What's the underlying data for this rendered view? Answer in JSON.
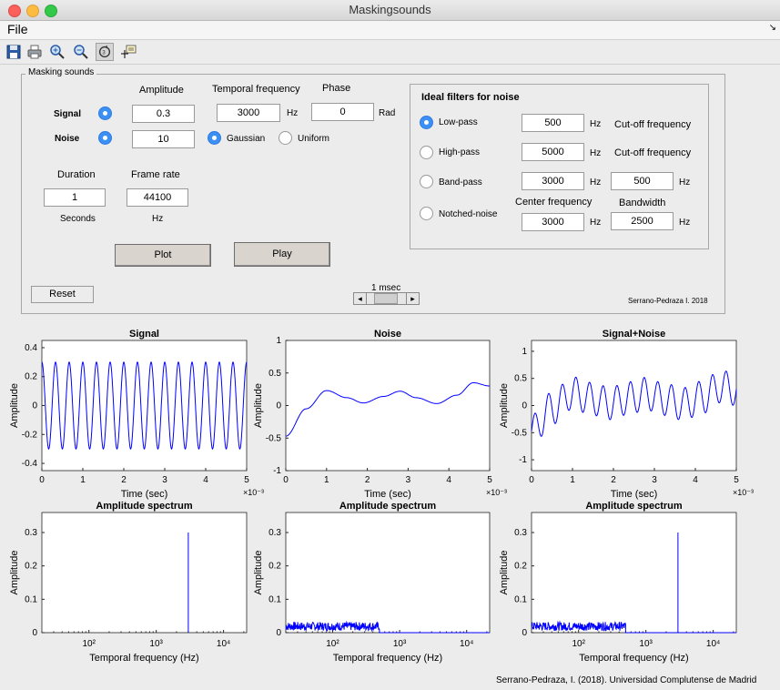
{
  "window": {
    "title": "Maskingsounds"
  },
  "menu": {
    "file": "File",
    "overflow": "↘"
  },
  "toolbar": {
    "items": [
      "save-icon",
      "print-icon",
      "zoom-in-icon",
      "zoom-out-icon",
      "rotate-3d-icon",
      "data-cursor-icon"
    ]
  },
  "panel": {
    "title": "Masking sounds",
    "headers": {
      "amplitude": "Amplitude",
      "temporal_frequency": "Temporal frequency",
      "phase": "Phase"
    },
    "signal": {
      "label": "Signal",
      "amplitude": "0.3",
      "frequency": "3000",
      "frequency_unit": "Hz",
      "phase": "0",
      "phase_unit": "Rad",
      "selected": true
    },
    "noise": {
      "label": "Noise",
      "amplitude": "10",
      "selected": true,
      "gaussian": "Gaussian",
      "uniform": "Uniform",
      "distribution": "Gaussian"
    },
    "duration": {
      "label": "Duration",
      "value": "1",
      "unit": "Seconds"
    },
    "frame_rate": {
      "label": "Frame rate",
      "value": "44100",
      "unit": "Hz"
    },
    "plot_button": "Plot",
    "play_button": "Play",
    "reset_button": "Reset",
    "slider": {
      "label": "1 msec",
      "left": "◂",
      "right": "▸"
    },
    "credit": "Serrano-Pedraza I. 2018",
    "filters": {
      "title": "Ideal filters for noise",
      "selected": "Low-pass",
      "lowpass": {
        "label": "Low-pass",
        "value": "500",
        "unit": "Hz",
        "desc": "Cut-off frequency"
      },
      "highpass": {
        "label": "High-pass",
        "value": "5000",
        "unit": "Hz",
        "desc": "Cut-off frequency"
      },
      "bandpass": {
        "label": "Band-pass",
        "center": "3000",
        "center_unit": "Hz",
        "bandwidth": "500",
        "bandwidth_unit": "Hz"
      },
      "notched": {
        "label": "Notched-noise",
        "center_label": "Center frequency",
        "bandwidth_label": "Bandwidth",
        "center": "3000",
        "center_unit": "Hz",
        "bandwidth": "2500",
        "bandwidth_unit": "Hz"
      }
    }
  },
  "footer": "Serrano-Pedraza, I. (2018). Universidad Complutense de Madrid",
  "colors": {
    "line": "#0000ff",
    "accent": "#3b8ff5"
  },
  "chart_data": [
    {
      "type": "line",
      "title": "Signal",
      "xlabel": "Time (sec)",
      "ylabel": "Amplitude",
      "x_multiplier": "×10⁻³",
      "xlim": [
        0,
        5
      ],
      "ylim": [
        -0.45,
        0.45
      ],
      "xticks": [
        0,
        1,
        2,
        3,
        4,
        5
      ],
      "yticks": [
        -0.4,
        -0.2,
        0,
        0.2,
        0.4
      ],
      "xticklabels": [
        "0",
        "1",
        "2",
        "3",
        "4",
        "5"
      ],
      "yticklabels": [
        "-0.4",
        "-0.2",
        "0",
        "0.2",
        "0.4"
      ],
      "series": [
        {
          "kind": "sine",
          "amplitude": 0.3,
          "frequency_khz": 3,
          "phase": 0
        }
      ]
    },
    {
      "type": "line",
      "title": "Noise",
      "xlabel": "Time (sec)",
      "ylabel": "Amplitude",
      "x_multiplier": "×10⁻³",
      "xlim": [
        0,
        5
      ],
      "ylim": [
        -1,
        1
      ],
      "xticks": [
        0,
        1,
        2,
        3,
        4,
        5
      ],
      "yticks": [
        -1,
        -0.5,
        0,
        0.5,
        1
      ],
      "xticklabels": [
        "0",
        "1",
        "2",
        "3",
        "4",
        "5"
      ],
      "yticklabels": [
        "-1",
        "-0.5",
        "0",
        "0.5",
        "1"
      ],
      "series": [
        {
          "kind": "points",
          "x": [
            0,
            0.5,
            1.0,
            1.5,
            1.9,
            2.4,
            2.8,
            3.2,
            3.7,
            4.2,
            4.6,
            5.0
          ],
          "y": [
            -0.47,
            -0.05,
            0.23,
            0.12,
            0.04,
            0.14,
            0.22,
            0.12,
            0.03,
            0.16,
            0.35,
            0.3
          ]
        }
      ]
    },
    {
      "type": "line",
      "title": "Signal+Noise",
      "xlabel": "Time (sec)",
      "ylabel": "Amplitude",
      "x_multiplier": "×10⁻³",
      "xlim": [
        0,
        5
      ],
      "ylim": [
        -1.2,
        1.2
      ],
      "xticks": [
        0,
        1,
        2,
        3,
        4,
        5
      ],
      "yticks": [
        -1,
        -0.5,
        0,
        0.5,
        1
      ],
      "xticklabels": [
        "0",
        "1",
        "2",
        "3",
        "4",
        "5"
      ],
      "yticklabels": [
        "-1",
        "-0.5",
        "0",
        "0.5",
        "1"
      ],
      "series": [
        {
          "kind": "sine_plus_trend",
          "amplitude": 0.3,
          "frequency_khz": 3,
          "trend_x": [
            0,
            0.5,
            1.0,
            1.5,
            1.9,
            2.4,
            2.8,
            3.2,
            3.7,
            4.2,
            4.6,
            5.0
          ],
          "trend_y": [
            -0.47,
            -0.05,
            0.23,
            0.12,
            0.04,
            0.14,
            0.22,
            0.12,
            0.03,
            0.16,
            0.35,
            0.3
          ]
        }
      ]
    },
    {
      "type": "line",
      "title": "Amplitude spectrum",
      "xlabel": "Temporal frequency (Hz)",
      "ylabel": "Amplitude",
      "xscale": "log",
      "xlim": [
        20,
        22050
      ],
      "ylim": [
        0,
        0.36
      ],
      "yticks": [
        0,
        0.1,
        0.2,
        0.3
      ],
      "yticklabels": [
        "0",
        "0.1",
        "0.2",
        "0.3"
      ],
      "xticklabels": [
        "10²",
        "10³",
        "10⁴"
      ],
      "series": [
        {
          "kind": "spike",
          "x": 3000,
          "y": 0.3
        }
      ]
    },
    {
      "type": "line",
      "title": "Amplitude spectrum",
      "xlabel": "Temporal frequency (Hz)",
      "ylabel": "Amplitude",
      "xscale": "log",
      "xlim": [
        20,
        22050
      ],
      "ylim": [
        0,
        0.36
      ],
      "yticks": [
        0,
        0.1,
        0.2,
        0.3
      ],
      "yticklabels": [
        "0",
        "0.1",
        "0.2",
        "0.3"
      ],
      "xticklabels": [
        "10²",
        "10³",
        "10⁴"
      ],
      "series": [
        {
          "kind": "noise_band",
          "x_from": 20,
          "x_to": 500,
          "level": 0.02
        }
      ]
    },
    {
      "type": "line",
      "title": "Amplitude spectrum",
      "xlabel": "Temporal frequency (Hz)",
      "ylabel": "Amplitude",
      "xscale": "log",
      "xlim": [
        20,
        22050
      ],
      "ylim": [
        0,
        0.36
      ],
      "yticks": [
        0,
        0.1,
        0.2,
        0.3
      ],
      "yticklabels": [
        "0",
        "0.1",
        "0.2",
        "0.3"
      ],
      "xticklabels": [
        "10²",
        "10³",
        "10⁴"
      ],
      "series": [
        {
          "kind": "noise_band",
          "x_from": 20,
          "x_to": 500,
          "level": 0.02
        },
        {
          "kind": "spike",
          "x": 3000,
          "y": 0.3
        }
      ]
    }
  ]
}
